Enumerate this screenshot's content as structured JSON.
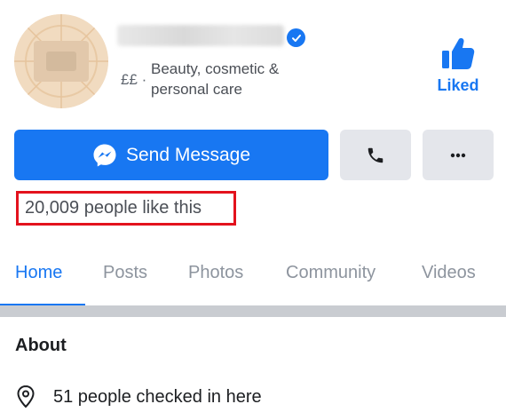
{
  "header": {
    "price_range": "££ ·",
    "category": "Beauty, cosmetic & personal care",
    "like_label": "Liked"
  },
  "actions": {
    "message_label": "Send Message"
  },
  "likes": {
    "count_text": "20,009 people like this"
  },
  "tabs": [
    {
      "label": "Home",
      "active": true
    },
    {
      "label": "Posts"
    },
    {
      "label": "Photos"
    },
    {
      "label": "Community"
    },
    {
      "label": "Videos"
    }
  ],
  "about": {
    "title": "About",
    "checkins_text": "51 people checked in here"
  },
  "colors": {
    "brand_blue": "#1877f2",
    "highlight_red": "#e3121d",
    "button_grey": "#e4e6eb"
  },
  "icons": [
    "verified-badge-icon",
    "thumbs-up-icon",
    "messenger-icon",
    "phone-icon",
    "more-dots-icon",
    "location-pin-icon"
  ]
}
